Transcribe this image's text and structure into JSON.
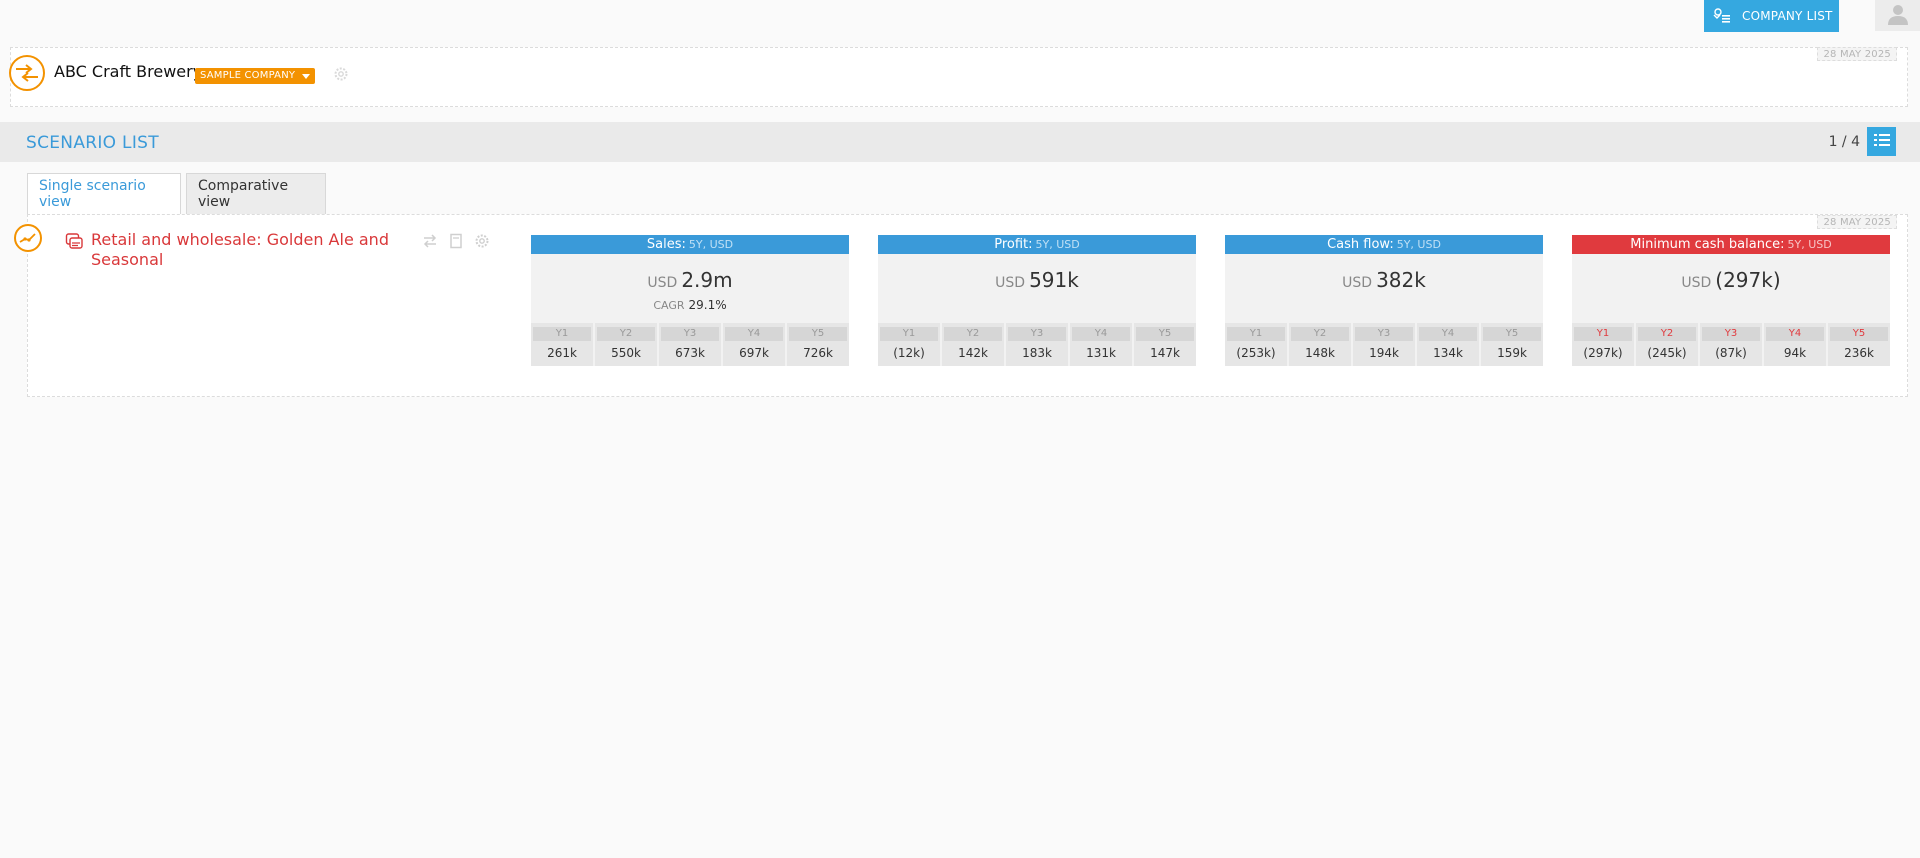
{
  "topbar": {
    "cards_icon": "cards-icon",
    "company_list_label": "COMPANY LIST",
    "avatar_icon": "user-icon"
  },
  "company": {
    "name": "ABC Craft Brewery",
    "badge": "SAMPLE COMPANY",
    "date": "28 MAY 2025"
  },
  "scenario_list": {
    "title": "SCENARIO LIST",
    "pager": "1 / 4"
  },
  "tabs": [
    {
      "label": "Single scenario view",
      "active": true
    },
    {
      "label": "Comparative view",
      "active": false
    }
  ],
  "scenario": {
    "name": "Retail and wholesale: Golden Ale and Seasonal",
    "date": "28 MAY 2025"
  },
  "kpis": [
    {
      "title": "Sales:",
      "sub": "5Y, USD",
      "currency": "USD",
      "value": "2.9m",
      "cagr_label": "CAGR",
      "cagr": "29.1%",
      "years": [
        {
          "label": "Y1",
          "value": "261k"
        },
        {
          "label": "Y2",
          "value": "550k"
        },
        {
          "label": "Y3",
          "value": "673k"
        },
        {
          "label": "Y4",
          "value": "697k"
        },
        {
          "label": "Y5",
          "value": "726k"
        }
      ]
    },
    {
      "title": "Profit:",
      "sub": "5Y, USD",
      "currency": "USD",
      "value": "591k",
      "years": [
        {
          "label": "Y1",
          "value": "(12k)"
        },
        {
          "label": "Y2",
          "value": "142k"
        },
        {
          "label": "Y3",
          "value": "183k"
        },
        {
          "label": "Y4",
          "value": "131k"
        },
        {
          "label": "Y5",
          "value": "147k"
        }
      ]
    },
    {
      "title": "Cash flow:",
      "sub": "5Y, USD",
      "currency": "USD",
      "value": "382k",
      "years": [
        {
          "label": "Y1",
          "value": "(253k)"
        },
        {
          "label": "Y2",
          "value": "148k"
        },
        {
          "label": "Y3",
          "value": "194k"
        },
        {
          "label": "Y4",
          "value": "134k"
        },
        {
          "label": "Y5",
          "value": "159k"
        }
      ]
    },
    {
      "title": "Minimum cash balance:",
      "sub": "5Y, USD",
      "currency": "USD",
      "value": "(297k)",
      "years": [
        {
          "label": "Y1",
          "value": "(297k)"
        },
        {
          "label": "Y2",
          "value": "(245k)"
        },
        {
          "label": "Y3",
          "value": "(87k)"
        },
        {
          "label": "Y4",
          "value": "94k"
        },
        {
          "label": "Y5",
          "value": "236k"
        }
      ]
    }
  ],
  "colors": {
    "accent_blue": "#35a8e0",
    "kpi_blue": "#3a9ad9",
    "alert_red": "#e03a3e",
    "brand_orange": "#f39200"
  }
}
